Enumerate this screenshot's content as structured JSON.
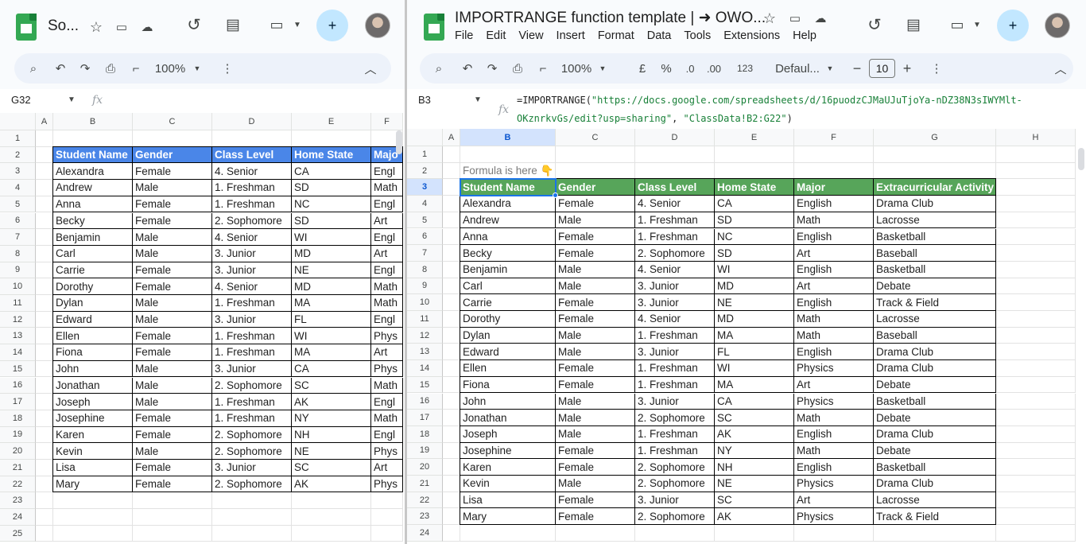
{
  "left": {
    "title": "So...",
    "zoom": "100%",
    "namebox": "G32",
    "fx": "fx",
    "columns": [
      "A",
      "B",
      "C",
      "D",
      "E",
      "F"
    ],
    "row_numbers": [
      "1",
      "2",
      "3",
      "4",
      "5",
      "6",
      "7",
      "8",
      "9",
      "10",
      "11",
      "12",
      "13",
      "14",
      "15",
      "16",
      "17",
      "18",
      "19",
      "20",
      "21",
      "22",
      "23",
      "24",
      "25"
    ],
    "table_header": [
      "Student Name",
      "Gender",
      "Class Level",
      "Home State",
      "Majo"
    ],
    "rows": [
      [
        "Alexandra",
        "Female",
        "4. Senior",
        "CA",
        "Engl"
      ],
      [
        "Andrew",
        "Male",
        "1. Freshman",
        "SD",
        "Math"
      ],
      [
        "Anna",
        "Female",
        "1. Freshman",
        "NC",
        "Engl"
      ],
      [
        "Becky",
        "Female",
        "2. Sophomore",
        "SD",
        "Art"
      ],
      [
        "Benjamin",
        "Male",
        "4. Senior",
        "WI",
        "Engl"
      ],
      [
        "Carl",
        "Male",
        "3. Junior",
        "MD",
        "Art"
      ],
      [
        "Carrie",
        "Female",
        "3. Junior",
        "NE",
        "Engl"
      ],
      [
        "Dorothy",
        "Female",
        "4. Senior",
        "MD",
        "Math"
      ],
      [
        "Dylan",
        "Male",
        "1. Freshman",
        "MA",
        "Math"
      ],
      [
        "Edward",
        "Male",
        "3. Junior",
        "FL",
        "Engl"
      ],
      [
        "Ellen",
        "Female",
        "1. Freshman",
        "WI",
        "Phys"
      ],
      [
        "Fiona",
        "Female",
        "1. Freshman",
        "MA",
        "Art"
      ],
      [
        "John",
        "Male",
        "3. Junior",
        "CA",
        "Phys"
      ],
      [
        "Jonathan",
        "Male",
        "2. Sophomore",
        "SC",
        "Math"
      ],
      [
        "Joseph",
        "Male",
        "1. Freshman",
        "AK",
        "Engl"
      ],
      [
        "Josephine",
        "Female",
        "1. Freshman",
        "NY",
        "Math"
      ],
      [
        "Karen",
        "Female",
        "2. Sophomore",
        "NH",
        "Engl"
      ],
      [
        "Kevin",
        "Male",
        "2. Sophomore",
        "NE",
        "Phys"
      ],
      [
        "Lisa",
        "Female",
        "3. Junior",
        "SC",
        "Art"
      ],
      [
        "Mary",
        "Female",
        "2. Sophomore",
        "AK",
        "Phys"
      ]
    ]
  },
  "right": {
    "title": "IMPORTRANGE function template | ➜ OWO...",
    "menu": [
      "File",
      "Edit",
      "View",
      "Insert",
      "Format",
      "Data",
      "Tools",
      "Extensions",
      "Help"
    ],
    "zoom": "100%",
    "currency": "£",
    "percent": "%",
    "dec_less": ".0",
    "dec_more": ".00",
    "number_format": "123",
    "font": "Defaul...",
    "font_size": "10",
    "namebox": "B3",
    "fx": "fx",
    "formula_prefix": "=IMPORTRANGE(",
    "formula_url": "\"https://docs.google.com/spreadsheets/d/16puodzCJMaUJuTjoYa-nDZ38N3sIWYMlt-",
    "formula_url_cont": "OKznrkvGs/edit?usp=sharing\"",
    "formula_sep": ", ",
    "formula_range": "\"ClassData!B2:G22\"",
    "formula_close": ")",
    "columns": [
      "A",
      "B",
      "C",
      "D",
      "E",
      "F",
      "G",
      "H"
    ],
    "row_numbers": [
      "1",
      "2",
      "3",
      "4",
      "5",
      "6",
      "7",
      "8",
      "9",
      "10",
      "11",
      "12",
      "13",
      "14",
      "15",
      "16",
      "17",
      "18",
      "19",
      "20",
      "21",
      "22",
      "23",
      "24"
    ],
    "note": "Formula is here 👇",
    "table_header": [
      "Student Name",
      "Gender",
      "Class Level",
      "Home State",
      "Major",
      "Extracurricular Activity"
    ],
    "rows": [
      [
        "Alexandra",
        "Female",
        "4. Senior",
        "CA",
        "English",
        "Drama Club"
      ],
      [
        "Andrew",
        "Male",
        "1. Freshman",
        "SD",
        "Math",
        "Lacrosse"
      ],
      [
        "Anna",
        "Female",
        "1. Freshman",
        "NC",
        "English",
        "Basketball"
      ],
      [
        "Becky",
        "Female",
        "2. Sophomore",
        "SD",
        "Art",
        "Baseball"
      ],
      [
        "Benjamin",
        "Male",
        "4. Senior",
        "WI",
        "English",
        "Basketball"
      ],
      [
        "Carl",
        "Male",
        "3. Junior",
        "MD",
        "Art",
        "Debate"
      ],
      [
        "Carrie",
        "Female",
        "3. Junior",
        "NE",
        "English",
        "Track & Field"
      ],
      [
        "Dorothy",
        "Female",
        "4. Senior",
        "MD",
        "Math",
        "Lacrosse"
      ],
      [
        "Dylan",
        "Male",
        "1. Freshman",
        "MA",
        "Math",
        "Baseball"
      ],
      [
        "Edward",
        "Male",
        "3. Junior",
        "FL",
        "English",
        "Drama Club"
      ],
      [
        "Ellen",
        "Female",
        "1. Freshman",
        "WI",
        "Physics",
        "Drama Club"
      ],
      [
        "Fiona",
        "Female",
        "1. Freshman",
        "MA",
        "Art",
        "Debate"
      ],
      [
        "John",
        "Male",
        "3. Junior",
        "CA",
        "Physics",
        "Basketball"
      ],
      [
        "Jonathan",
        "Male",
        "2. Sophomore",
        "SC",
        "Math",
        "Debate"
      ],
      [
        "Joseph",
        "Male",
        "1. Freshman",
        "AK",
        "English",
        "Drama Club"
      ],
      [
        "Josephine",
        "Female",
        "1. Freshman",
        "NY",
        "Math",
        "Debate"
      ],
      [
        "Karen",
        "Female",
        "2. Sophomore",
        "NH",
        "English",
        "Basketball"
      ],
      [
        "Kevin",
        "Male",
        "2. Sophomore",
        "NE",
        "Physics",
        "Drama Club"
      ],
      [
        "Lisa",
        "Female",
        "3. Junior",
        "SC",
        "Art",
        "Lacrosse"
      ],
      [
        "Mary",
        "Female",
        "2. Sophomore",
        "AK",
        "Physics",
        "Track & Field"
      ]
    ]
  }
}
